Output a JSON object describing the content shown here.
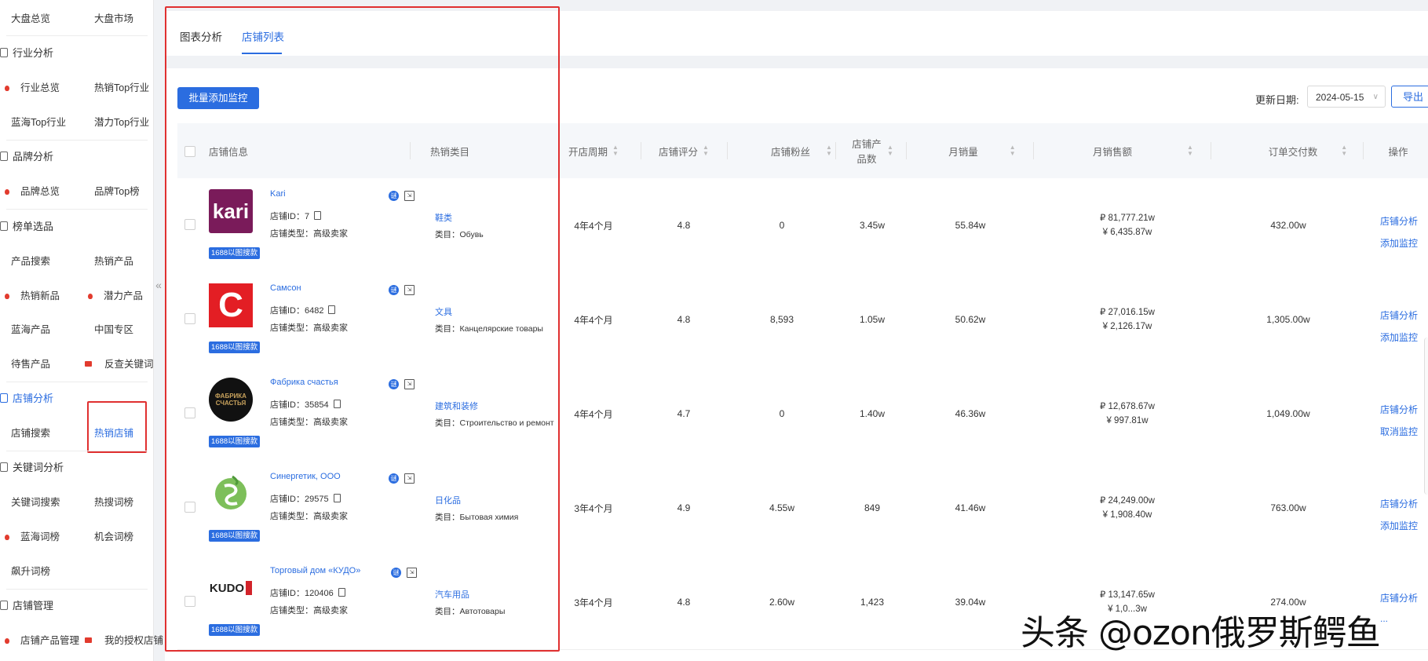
{
  "sidebar": {
    "rows": [
      {
        "c1": "大盘总览",
        "c2": "大盘市场"
      },
      {
        "c1": "行业总览",
        "c2": "热销Top行业",
        "c1_fire": true
      },
      {
        "c1": "蓝海Top行业",
        "c2": "潜力Top行业"
      },
      {
        "c1": "品牌总览",
        "c2": "品牌Top榜",
        "c1_fire": true
      },
      {
        "c1": "产品搜索",
        "c2": "热销产品"
      },
      {
        "c1": "热销新品",
        "c2": "潜力产品",
        "c1_fire": true,
        "c2_fire": true
      },
      {
        "c1": "蓝海产品",
        "c2": "中国专区"
      },
      {
        "c1": "待售产品",
        "c2": "反查关键词",
        "c2_tag": true
      },
      {
        "c1": "店铺搜索",
        "c2": "热销店铺"
      },
      {
        "c1": "关键词搜索",
        "c2": "热搜词榜"
      },
      {
        "c1": "蓝海词榜",
        "c2": "机会词榜",
        "c1_fire": true
      },
      {
        "c1": "飙升词榜",
        "c2": ""
      },
      {
        "c1": "店铺产品管理",
        "c2": "我的授权店铺",
        "c1_fire": true,
        "c2_tag": true
      }
    ],
    "sections": {
      "industry": "行业分析",
      "brand": "品牌分析",
      "ranking": "榜单选品",
      "shop": "店铺分析",
      "keyword": "关键词分析",
      "manage": "店铺管理"
    }
  },
  "tabs": [
    "图表分析",
    "店铺列表"
  ],
  "toolbar": {
    "batch_button": "批量添加监控",
    "date_label": "更新日期:",
    "date_value": "2024-05-15",
    "export_label": "导出"
  },
  "table": {
    "headers": {
      "shop_info": "店铺信息",
      "category": "热销类目",
      "period": "开店周期",
      "rating": "店铺评分",
      "fans": "店铺粉丝",
      "products": "店铺产品数",
      "monthly_qty": "月销量",
      "monthly_sales": "月销售额",
      "orders": "订单交付数",
      "action": "操作"
    },
    "rows": [
      {
        "name": "Kari",
        "id_label": "店铺ID：",
        "id": "7",
        "type_label": "店铺类型：",
        "type": "高级卖家",
        "badge": "1688以图搜款",
        "category": "鞋类",
        "cat_sub_label": "类目：",
        "cat_sub": "Обувь",
        "period": "4年4个月",
        "rating": "4.8",
        "fans": "0",
        "products": "3.45w",
        "monthly_qty": "55.84w",
        "sales_rub": "₽ 81,777.21w",
        "sales_cny": "¥ 6,435.87w",
        "orders": "432.00w",
        "op1": "店铺分析",
        "op2": "添加监控",
        "logo": "kari"
      },
      {
        "name": "Самсон",
        "id_label": "店铺ID：",
        "id": "6482",
        "type_label": "店铺类型：",
        "type": "高级卖家",
        "badge": "1688以图搜款",
        "category": "文具",
        "cat_sub_label": "类目：",
        "cat_sub": "Канцелярские товары",
        "period": "4年4个月",
        "rating": "4.8",
        "fans": "8,593",
        "products": "1.05w",
        "monthly_qty": "50.62w",
        "sales_rub": "₽ 27,016.15w",
        "sales_cny": "¥ 2,126.17w",
        "orders": "1,305.00w",
        "op1": "店铺分析",
        "op2": "添加监控",
        "logo": "samson"
      },
      {
        "name": "Фабрика счастья",
        "id_label": "店铺ID：",
        "id": "35854",
        "type_label": "店铺类型：",
        "type": "高级卖家",
        "badge": "1688以图搜款",
        "category": "建筑和装修",
        "cat_sub_label": "类目：",
        "cat_sub": "Строительство и ремонт",
        "period": "4年4个月",
        "rating": "4.7",
        "fans": "0",
        "products": "1.40w",
        "monthly_qty": "46.36w",
        "sales_rub": "₽ 12,678.67w",
        "sales_cny": "¥ 997.81w",
        "orders": "1,049.00w",
        "op1": "店铺分析",
        "op2": "取消监控",
        "logo": "fabrika"
      },
      {
        "name": "Синергетик, ООО",
        "id_label": "店铺ID：",
        "id": "29575",
        "type_label": "店铺类型：",
        "type": "高级卖家",
        "badge": "1688以图搜款",
        "category": "日化品",
        "cat_sub_label": "类目：",
        "cat_sub": "Бытовая химия",
        "period": "3年4个月",
        "rating": "4.9",
        "fans": "4.55w",
        "products": "849",
        "monthly_qty": "41.46w",
        "sales_rub": "₽ 24,249.00w",
        "sales_cny": "¥ 1,908.40w",
        "orders": "763.00w",
        "op1": "店铺分析",
        "op2": "添加监控",
        "logo": "synergetic"
      },
      {
        "name": "Торговый дом «КУДО»",
        "id_label": "店铺ID：",
        "id": "120406",
        "type_label": "店铺类型：",
        "type": "高级卖家",
        "badge": "1688以图搜款",
        "category": "汽车用品",
        "cat_sub_label": "类目：",
        "cat_sub": "Автотовары",
        "period": "3年4个月",
        "rating": "4.8",
        "fans": "2.60w",
        "products": "1,423",
        "monthly_qty": "39.04w",
        "sales_rub": "₽ 13,147.65w",
        "sales_cny": "¥ 1,0...3w",
        "orders": "274.00w",
        "op1": "店铺分析",
        "op2": "...",
        "logo": "kudo"
      }
    ]
  },
  "logos": {
    "kari": "kari",
    "samson": "C",
    "fabrika": "ФАБРИКА СЧАСТЬЯ",
    "kudo": "KUDO"
  },
  "icons": {
    "row_badge_blue": "谜",
    "row_badge_sq": "⇲"
  },
  "watermark": "头条 @ozon俄罗斯鳄鱼",
  "colors": {
    "accent": "#2b6de0",
    "highlight_box": "#e03030",
    "fire": "#e23b2e"
  }
}
